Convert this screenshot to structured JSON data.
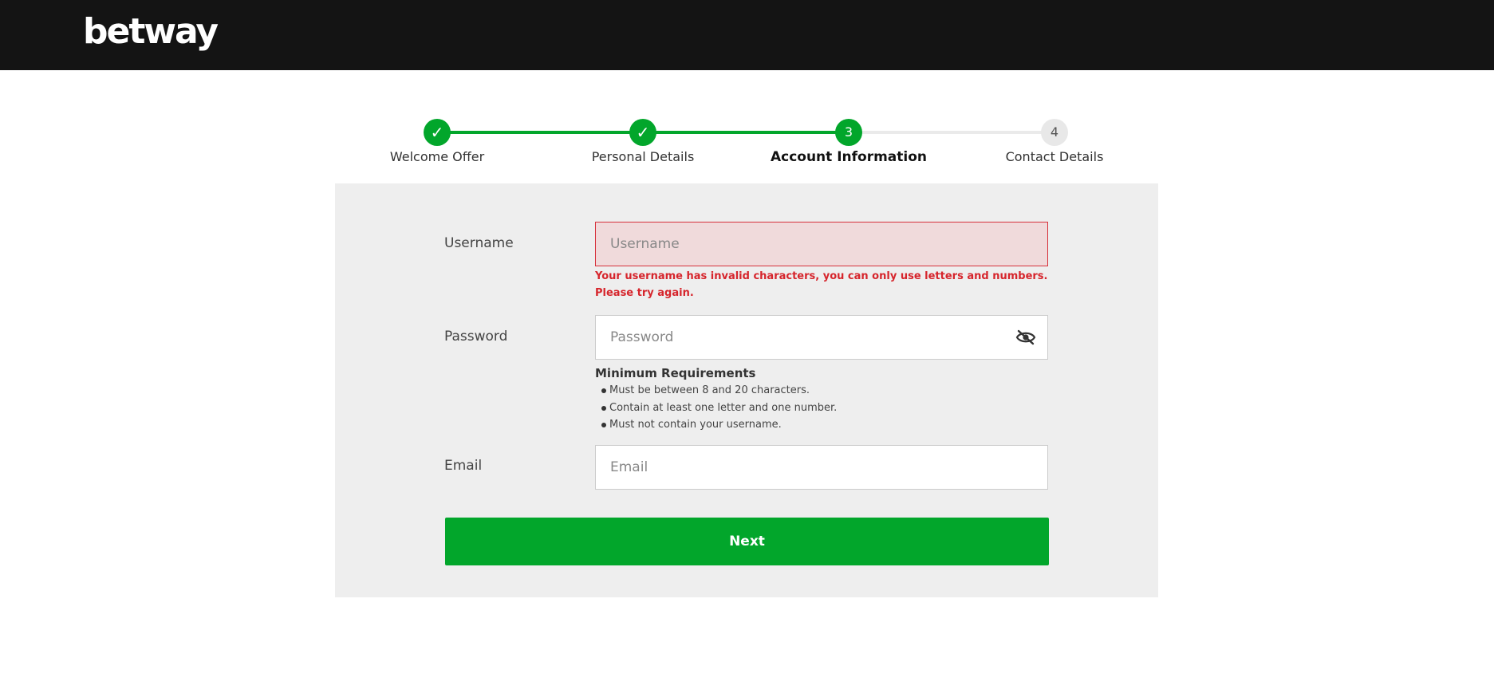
{
  "header": {
    "logo_text": "betway"
  },
  "stepper": {
    "steps": [
      {
        "number": "1",
        "label": "Welcome Offer",
        "state": "done",
        "icon": "check-icon"
      },
      {
        "number": "2",
        "label": "Personal Details",
        "state": "done",
        "icon": "check-icon"
      },
      {
        "number": "3",
        "label": "Account Information",
        "state": "current"
      },
      {
        "number": "4",
        "label": "Contact Details",
        "state": "todo"
      }
    ],
    "check_glyph": "✓"
  },
  "form": {
    "username": {
      "label": "Username",
      "placeholder": "Username",
      "value": "",
      "error": "Your username has invalid characters, you can only use letters and numbers. Please try again."
    },
    "password": {
      "label": "Password",
      "placeholder": "Password",
      "value": "",
      "toggle_icon": "eye-slash-icon",
      "requirements_title": "Minimum Requirements",
      "requirements": [
        "Must be between 8 and 20 characters.",
        "Contain at least one letter and one number.",
        "Must not contain your username."
      ]
    },
    "email": {
      "label": "Email",
      "placeholder": "Email",
      "value": ""
    },
    "next_label": "Next"
  },
  "colors": {
    "brand_green": "#02a62b",
    "header_bg": "#141414",
    "error_red": "#d6252c",
    "panel_bg": "#eeeeee"
  }
}
